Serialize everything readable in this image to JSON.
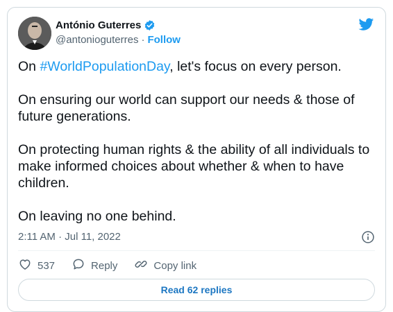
{
  "author": {
    "name": "António Guterres",
    "handle": "@antonioguterres",
    "separator": "·",
    "follow_label": "Follow",
    "verified": true
  },
  "tweet": {
    "p1_prefix": "On ",
    "p1_hashtag": "#WorldPopulationDay",
    "p1_suffix": ", let's focus on every person.",
    "p2": "On ensuring our world can support our needs & those of future generations.",
    "p3": "On protecting human rights & the ability of all individuals to make informed choices about whether & when to have children.",
    "p4": "On leaving no one behind."
  },
  "meta": {
    "timestamp": "2:11 AM · Jul 11, 2022"
  },
  "actions": {
    "like_count": "537",
    "reply_label": "Reply",
    "copy_label": "Copy link"
  },
  "footer": {
    "read_replies_label": "Read 62 replies"
  },
  "icons": {
    "verified": "verified-badge-icon",
    "bird": "twitter-bird-icon",
    "info": "info-icon",
    "like": "heart-icon",
    "reply": "reply-bubble-icon",
    "copy": "link-icon"
  },
  "colors": {
    "accent": "#1d9bf0",
    "text": "#0f1419",
    "muted": "#536471",
    "border": "#cfd9de"
  }
}
